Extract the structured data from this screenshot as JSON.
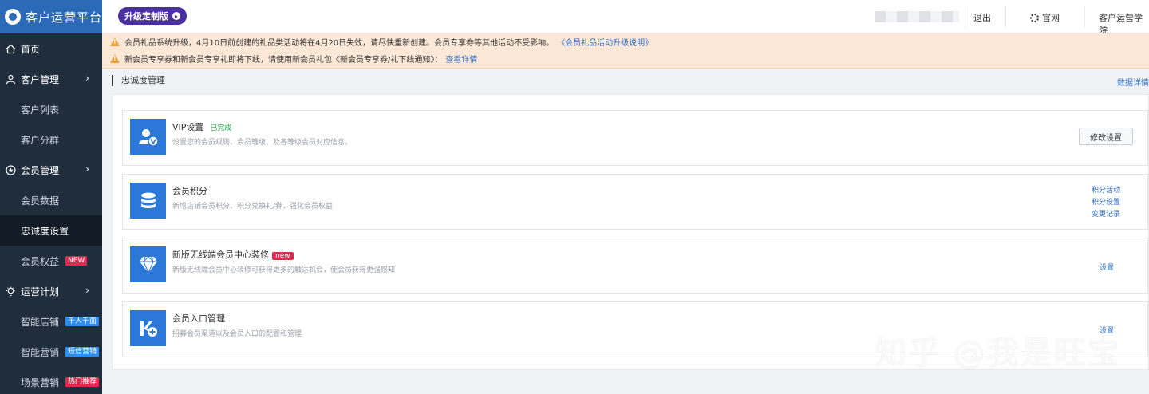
{
  "sidebar": {
    "brand_title": "客户运营平台",
    "items": [
      {
        "label": "首页",
        "level": "top",
        "icon": "home-icon"
      },
      {
        "label": "客户管理",
        "level": "top",
        "icon": "user-icon",
        "expandable": true
      },
      {
        "label": "客户列表",
        "level": "sub"
      },
      {
        "label": "客户分群",
        "level": "sub"
      },
      {
        "label": "会员管理",
        "level": "top",
        "icon": "member-icon",
        "expandable": true
      },
      {
        "label": "会员数据",
        "level": "sub"
      },
      {
        "label": "忠诚度设置",
        "level": "sub",
        "active": true
      },
      {
        "label": "会员权益",
        "level": "sub",
        "tag": "NEW"
      },
      {
        "label": "运营计划",
        "level": "top",
        "icon": "bulb-icon",
        "expandable": true
      },
      {
        "label": "智能店铺",
        "level": "sub",
        "tag": "千人千面"
      },
      {
        "label": "智能营销",
        "level": "sub",
        "tag": "短信营销"
      },
      {
        "label": "场景营销",
        "level": "sub",
        "tag": "热门推荐"
      }
    ]
  },
  "header": {
    "upgrade_badge": "升级定制版",
    "logout": "退出",
    "official_site": "官网",
    "academy": "客户运营学院"
  },
  "notice": {
    "line1": "会员礼品系统升级，4月10日前创建的礼品类活动将在4月20日失效，请尽快重新创建。会员专享券等其他活动不受影响。",
    "line1_link": "《会员礼品活动升级说明》",
    "line2": "新会员专享券和新会员专享礼即将下线，请使用新会员礼包《新会员专享券/礼下线通知》：",
    "line2_link": "查看详情"
  },
  "page": {
    "title": "忠诚度管理",
    "right_link": "数据详情"
  },
  "cards": [
    {
      "title": "VIP设置",
      "status": "已完成",
      "desc": "设置您的会员规则、会员等级、及各等级会员对应信息。",
      "button": "修改设置",
      "icon": "vip-user-icon"
    },
    {
      "title": "会员积分",
      "desc": "新增店铺会员积分、积分兑换礼/券，强化会员权益",
      "links": [
        "积分活动",
        "积分设置",
        "变更记录"
      ],
      "icon": "database-icon"
    },
    {
      "title": "新版无线端会员中心装修",
      "badge": "new",
      "desc": "新版无线端会员中心装修可获得更多的触达机会，使会员获得更强感知",
      "link": "设置",
      "icon": "diamond-icon"
    },
    {
      "title": "会员入口管理",
      "desc": "招募会员渠道以及会员入口的配置和管理",
      "link": "设置",
      "icon": "k-plus-icon"
    }
  ],
  "watermark": "知乎 @我是旺宝"
}
